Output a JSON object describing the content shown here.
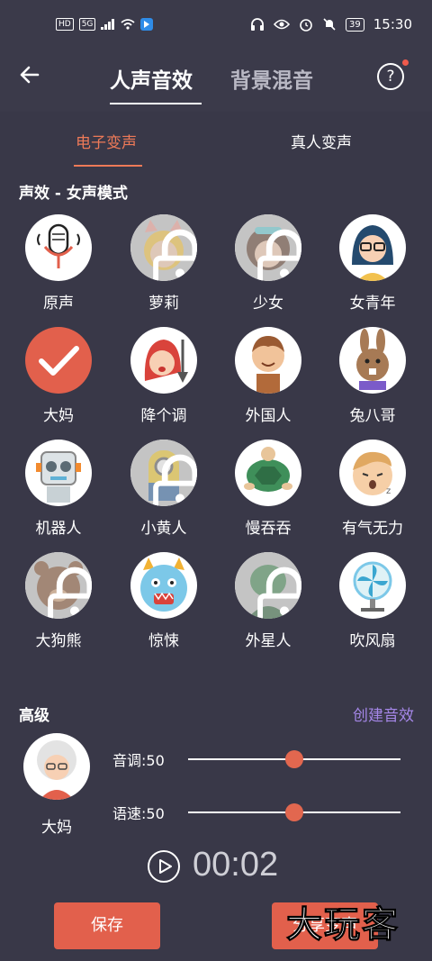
{
  "status_bar": {
    "left_chips": [
      "HD",
      "5G"
    ],
    "battery": "39",
    "time": "15:30"
  },
  "header": {
    "tabs": [
      {
        "label": "人声音效",
        "active": true
      },
      {
        "label": "背景混音",
        "active": false
      }
    ],
    "help_label": "?"
  },
  "sub_tabs": [
    {
      "label": "电子变声",
      "active": true
    },
    {
      "label": "真人变声",
      "active": false
    }
  ],
  "section_title": "声效 - 女声模式",
  "effects": [
    {
      "label": "原声",
      "icon": "microphone-icon",
      "locked": false,
      "selected": false
    },
    {
      "label": "萝莉",
      "icon": "cat-girl-icon",
      "locked": true,
      "selected": false
    },
    {
      "label": "少女",
      "icon": "girl-icon",
      "locked": true,
      "selected": false
    },
    {
      "label": "女青年",
      "icon": "young-woman-icon",
      "locked": false,
      "selected": false
    },
    {
      "label": "大妈",
      "icon": "checkmark-icon",
      "locked": false,
      "selected": true
    },
    {
      "label": "降个调",
      "icon": "red-hood-girl-icon",
      "locked": false,
      "selected": false
    },
    {
      "label": "外国人",
      "icon": "foreigner-icon",
      "locked": false,
      "selected": false
    },
    {
      "label": "兔八哥",
      "icon": "rabbit-icon",
      "locked": false,
      "selected": false
    },
    {
      "label": "机器人",
      "icon": "robot-icon",
      "locked": false,
      "selected": false
    },
    {
      "label": "小黄人",
      "icon": "minion-icon",
      "locked": true,
      "selected": false
    },
    {
      "label": "慢吞吞",
      "icon": "turtle-icon",
      "locked": false,
      "selected": false
    },
    {
      "label": "有气无力",
      "icon": "sleepy-face-icon",
      "locked": false,
      "selected": false
    },
    {
      "label": "大狗熊",
      "icon": "bear-icon",
      "locked": true,
      "selected": false
    },
    {
      "label": "惊悚",
      "icon": "monster-icon",
      "locked": false,
      "selected": false
    },
    {
      "label": "外星人",
      "icon": "alien-icon",
      "locked": true,
      "selected": false
    },
    {
      "label": "吹风扇",
      "icon": "fan-icon",
      "locked": false,
      "selected": false
    }
  ],
  "advanced": {
    "title": "高级",
    "create_label": "创建音效",
    "current_effect": "大妈",
    "sliders": [
      {
        "label": "音调:50",
        "value": 50
      },
      {
        "label": "语速:50",
        "value": 50
      }
    ]
  },
  "player": {
    "time": "00:02"
  },
  "buttons": {
    "save": "保存",
    "share": "分享变声"
  },
  "watermark": "大玩客",
  "colors": {
    "accent": "#e2604c",
    "link": "#a587e8",
    "background": "#393848"
  }
}
